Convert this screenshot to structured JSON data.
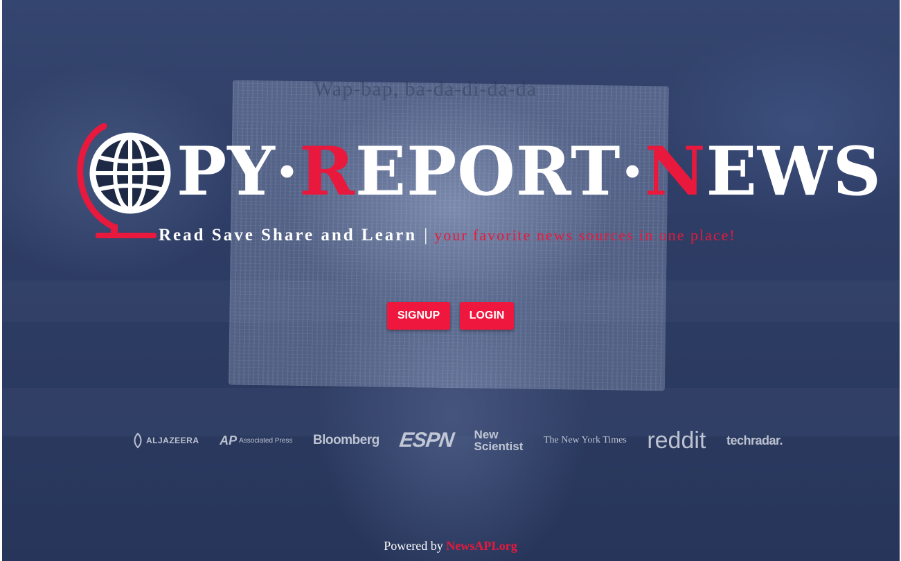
{
  "brand": {
    "title_parts": [
      {
        "text": "PY·",
        "accent": false
      },
      {
        "text": "R",
        "accent": true
      },
      {
        "text": "EPORT·",
        "accent": false
      },
      {
        "text": "N",
        "accent": true
      },
      {
        "text": "EWS",
        "accent": false
      }
    ],
    "tagline_main": "Read Save Share and Learn",
    "tagline_sep": "|",
    "tagline_sub": "your favorite news sources in one place!",
    "accent_color": "#e8193d",
    "logo_icon": "globe-icon"
  },
  "actions": {
    "signup_label": "SIGNUP",
    "login_label": "LOGIN",
    "button_color": "#f0173e"
  },
  "sources": [
    {
      "id": "aljazeera",
      "label": "ALJAZEERA"
    },
    {
      "id": "ap",
      "mark": "AP",
      "label": "Associated Press"
    },
    {
      "id": "bloomberg",
      "label": "Bloomberg"
    },
    {
      "id": "espn",
      "label": "ESPN"
    },
    {
      "id": "newscientist",
      "label": "New\nScientist"
    },
    {
      "id": "nyt",
      "label": "The New York Times"
    },
    {
      "id": "reddit",
      "label": "reddit"
    },
    {
      "id": "techradar",
      "label": "techradar."
    }
  ],
  "footer": {
    "prefix": "Powered by",
    "link_text": "NewsAPI.org"
  }
}
